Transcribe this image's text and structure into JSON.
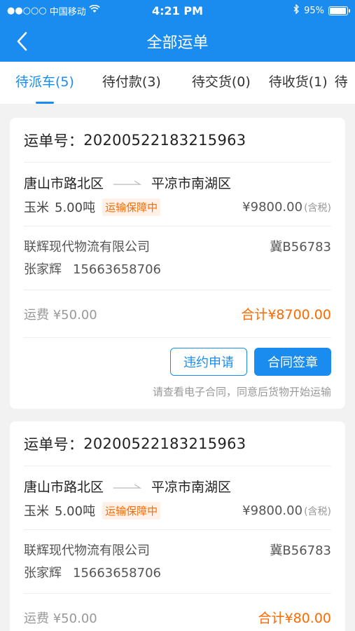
{
  "status_bar": {
    "signal": "●●○○○",
    "carrier": "中国移动",
    "time": "4:21 PM",
    "battery": "95%",
    "battery_level": 0.95
  },
  "navbar": {
    "title": "全部运单"
  },
  "tabs": [
    {
      "label": "待派车(5)",
      "active": true
    },
    {
      "label": "待付款(3)"
    },
    {
      "label": "待交货(0)"
    },
    {
      "label": "待收货(1)"
    },
    {
      "label": "待"
    }
  ],
  "colors": {
    "primary": "#1a8cf0",
    "accent": "#ff6a00"
  },
  "orders": [
    {
      "order_label": "运单号：",
      "order_no": "20200522183215963",
      "from": "唐山市路北区",
      "to": "平凉市南湖区",
      "goods": "玉米",
      "weight": "5.00吨",
      "tag": "运输保障中",
      "price": "¥9800.00",
      "tax": "(含税)",
      "company": "联辉现代物流有限公司",
      "plate": "冀B56783",
      "driver": "张家辉",
      "phone": "15663658706",
      "fee_label": "运费",
      "fee": "¥50.00",
      "total_label": "合计",
      "total": "¥8700.00",
      "btn_breach": "违约申请",
      "btn_sign": "合同签章",
      "hint": "请查看电子合同，同意后货物开始运输"
    },
    {
      "order_label": "运单号：",
      "order_no": "20200522183215963",
      "from": "唐山市路北区",
      "to": "平凉市南湖区",
      "goods": "玉米",
      "weight": "5.00吨",
      "tag": "运输保障中",
      "price": "¥9800.00",
      "tax": "(含税)",
      "company": "联辉现代物流有限公司",
      "plate": "冀B56783",
      "driver": "张家辉",
      "phone": "15663658706",
      "fee_label": "运费",
      "fee": "¥50.00",
      "total_label": "合计",
      "total": "¥80.00"
    }
  ]
}
